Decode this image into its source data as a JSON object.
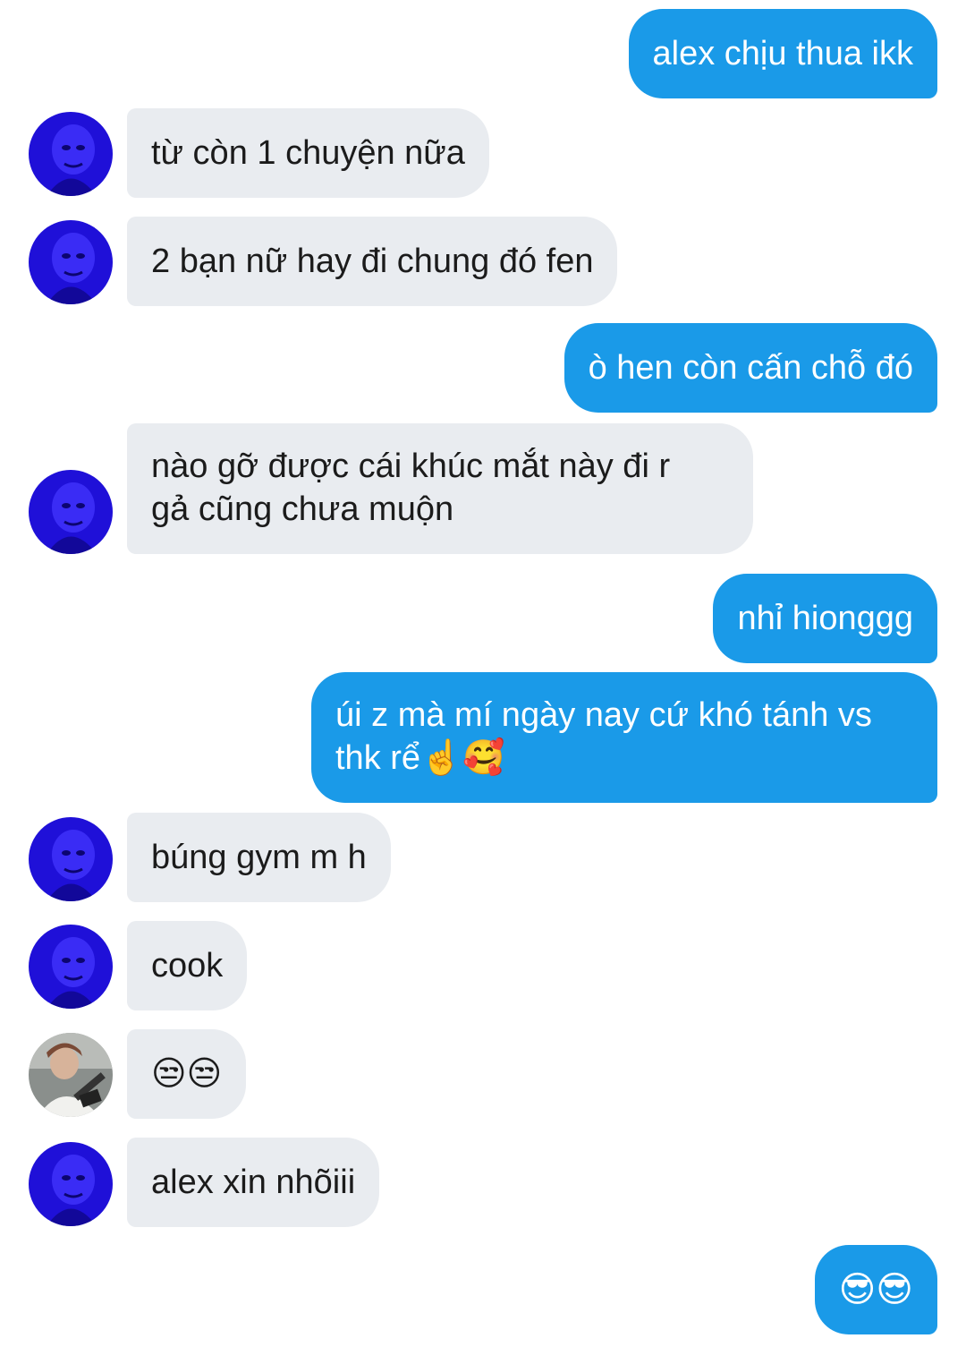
{
  "conversation": {
    "messages": [
      {
        "from": "me",
        "text": "alex chịu thua ikk"
      },
      {
        "from": "friend_a",
        "text": "từ còn 1 chuyện nữa"
      },
      {
        "from": "friend_a",
        "text": "2 bạn nữ hay đi chung đó fen"
      },
      {
        "from": "me",
        "text": "ò hen còn cấn chỗ đó"
      },
      {
        "from": "friend_a",
        "text": "nào gỡ được cái khúc mắt này đi r\ngả cũng chưa muộn"
      },
      {
        "from": "me",
        "text": "nhỉ hionggg"
      },
      {
        "from": "me",
        "text": "úi z mà mí ngày nay cứ khó tánh vs\nthk rể☝️🥰"
      },
      {
        "from": "friend_a",
        "text": "búng gym m h"
      },
      {
        "from": "friend_a",
        "text": "cook"
      },
      {
        "from": "friend_b",
        "text": "😒😒"
      },
      {
        "from": "friend_a",
        "text": "alex xin nhõiii"
      },
      {
        "from": "me",
        "text": "😎😎"
      }
    ]
  },
  "colors": {
    "outgoing_bubble": "#1a9ae8",
    "incoming_bubble": "#e9ecf0",
    "avatar_blue": "#1f10d8"
  }
}
